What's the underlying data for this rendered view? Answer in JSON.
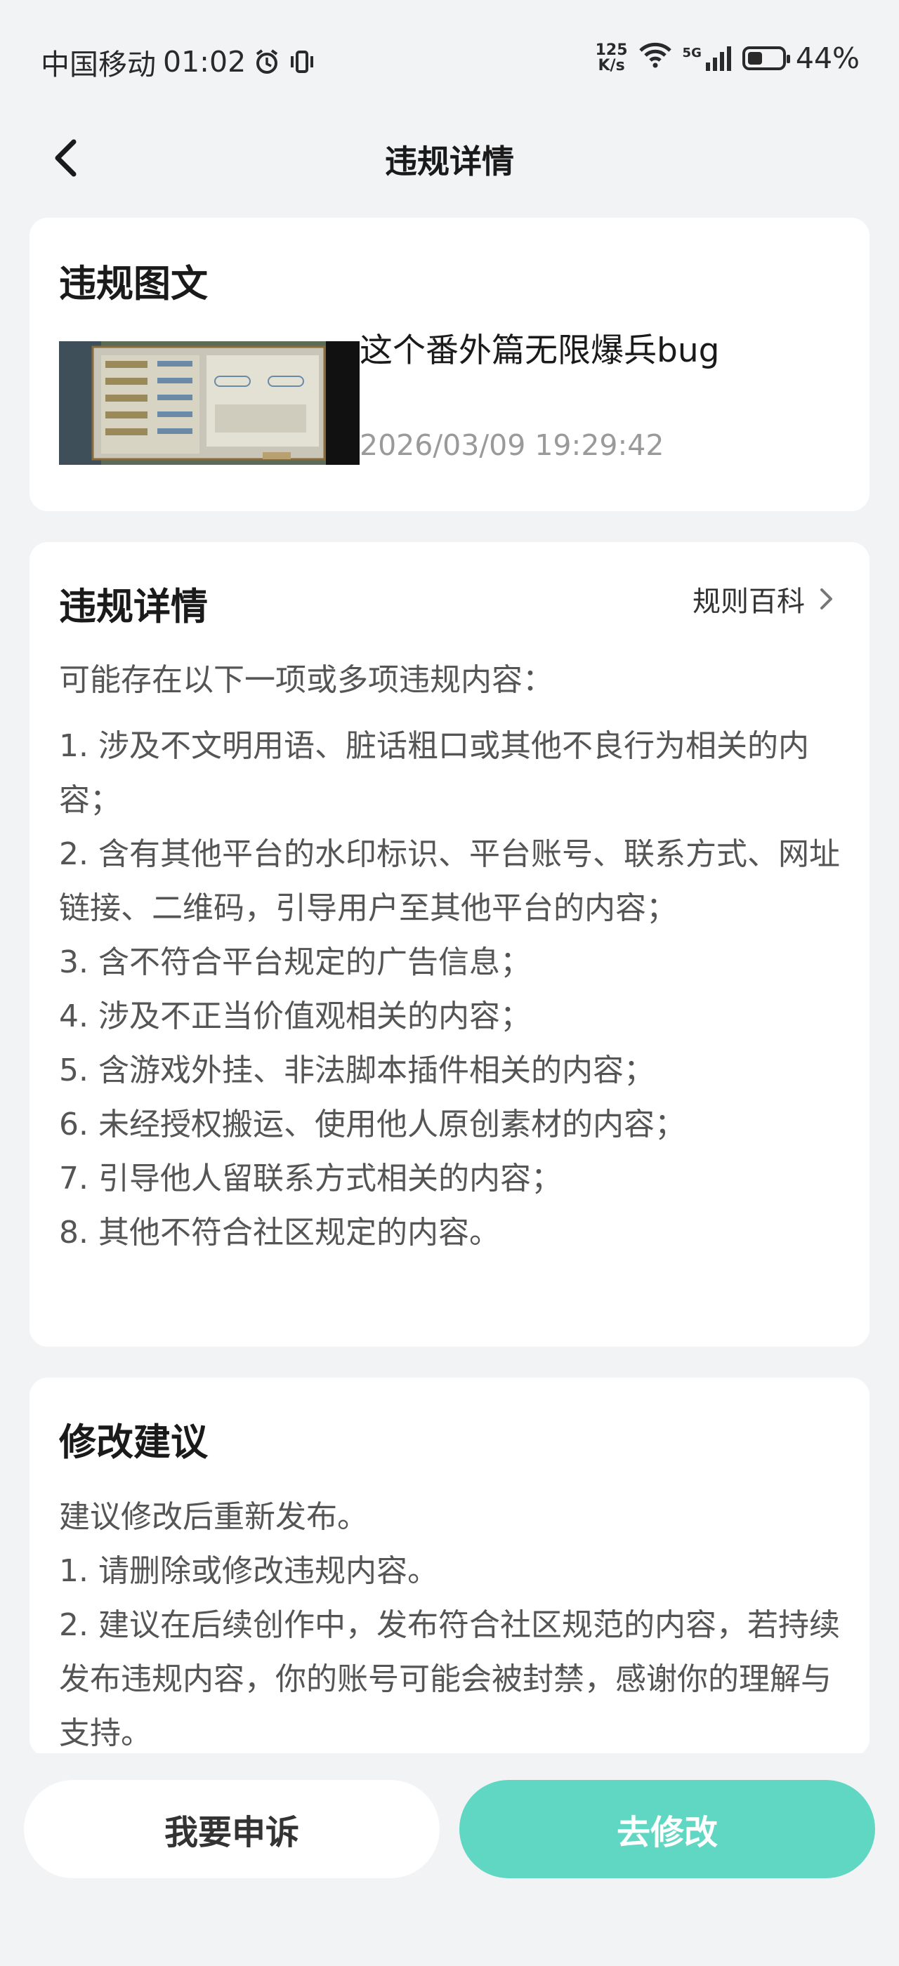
{
  "status_bar": {
    "carrier": "中国移动",
    "time": "01:02",
    "speed_value": "125",
    "speed_unit": "K/s",
    "network": "5G",
    "battery": "44%",
    "battery_level": 0.44
  },
  "nav": {
    "title": "违规详情"
  },
  "post_card": {
    "heading": "违规图文",
    "post_title": "这个番外篇无限爆兵bug",
    "post_time": "2026/03/09 19:29:42"
  },
  "details_card": {
    "heading": "违规详情",
    "rules_link": "规则百科",
    "intro": "可能存在以下一项或多项违规内容：",
    "items": [
      "1. 涉及不文明用语、脏话粗口或其他不良行为相关的内容；",
      "2. 含有其他平台的水印标识、平台账号、联系方式、网址链接、二维码，引导用户至其他平台的内容；",
      "3. 含不符合平台规定的广告信息；",
      "4. 涉及不正当价值观相关的内容；",
      "5. 含游戏外挂、非法脚本插件相关的内容；",
      "6. 未经授权搬运、使用他人原创素材的内容；",
      "7. 引导他人留联系方式相关的内容；",
      "8. 其他不符合社区规定的内容。"
    ]
  },
  "suggestion_card": {
    "heading": "修改建议",
    "lines": [
      "建议修改后重新发布。",
      "1. 请删除或修改违规内容。",
      "2. 建议在后续创作中，发布符合社区规范的内容，若持续发布违规内容，你的账号可能会被封禁，感谢你的理解与支持。"
    ]
  },
  "actions": {
    "appeal_label": "我要申诉",
    "modify_label": "去修改"
  },
  "colors": {
    "accent": "#5fd7c3",
    "background": "#f2f3f5",
    "card": "#ffffff"
  }
}
